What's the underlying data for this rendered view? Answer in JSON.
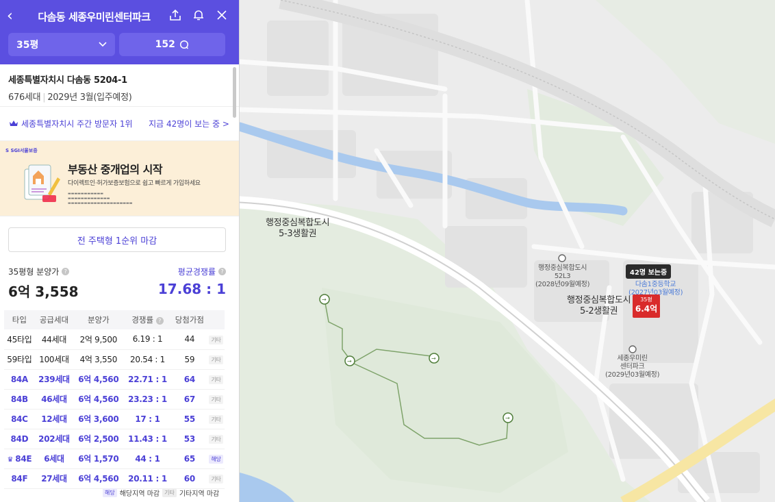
{
  "header": {
    "back_icon": "chevron-left-icon",
    "title": "다솜동 세종우미린센터파크",
    "size_selector": "35평",
    "comment_count": "152"
  },
  "address": {
    "line1": "세종특별자치시 다솜동 5204-1",
    "households": "676세대",
    "move_in": "2029년 3월(입주예정)"
  },
  "rank": {
    "left": "세종특별자치시 주간 방문자 1위",
    "right": "지금 42명이 보는 중 >"
  },
  "banner": {
    "title": "부동산 중개업의 시작",
    "subtitle": "다이렉트인·허가보증보험으로 쉽고 빠르게 가입하세요"
  },
  "closed_button": "전 주택형 1순위 마감",
  "price": {
    "label": "35평형 분양가",
    "value": "6억 3,558",
    "comp_label": "평균경쟁률",
    "comp_value": "17.68 : 1"
  },
  "table": {
    "headers": [
      "타입",
      "공급세대",
      "분양가",
      "경쟁률",
      "당첨가점",
      ""
    ],
    "rows": [
      {
        "type": "45타입",
        "supply": "44세대",
        "price": "2억 9,500",
        "rate": "6.19 : 1",
        "score": "44",
        "tag": "기타",
        "hl": false
      },
      {
        "type": "59타입",
        "supply": "100세대",
        "price": "4억 3,550",
        "rate": "20.54 : 1",
        "score": "59",
        "tag": "기타",
        "hl": false
      },
      {
        "type": "84A",
        "supply": "239세대",
        "price": "6억 4,560",
        "rate": "22.71 : 1",
        "score": "64",
        "tag": "기타",
        "hl": true
      },
      {
        "type": "84B",
        "supply": "46세대",
        "price": "6억 4,560",
        "rate": "23.23 : 1",
        "score": "67",
        "tag": "기타",
        "hl": true
      },
      {
        "type": "84C",
        "supply": "12세대",
        "price": "6억 3,600",
        "rate": "17 : 1",
        "score": "55",
        "tag": "기타",
        "hl": true
      },
      {
        "type": "84D",
        "supply": "202세대",
        "price": "6억 2,500",
        "rate": "11.43 : 1",
        "score": "53",
        "tag": "기타",
        "hl": true
      },
      {
        "type": "84E",
        "supply": "6세대",
        "price": "6억 1,570",
        "rate": "44 : 1",
        "score": "65",
        "tag": "해당",
        "hl": true
      },
      {
        "type": "84F",
        "supply": "27세대",
        "price": "6억 4,560",
        "rate": "20.11 : 1",
        "score": "60",
        "tag": "기타",
        "hl": true
      }
    ]
  },
  "legend": {
    "chip1": "해당",
    "label1": "해당지역 마감",
    "chip2": "기타",
    "label2": "기타지역 마감"
  },
  "map": {
    "labels": {
      "area1": "행정중심복합도시\n5-3생활권",
      "area2": "행정중심복합도시\n5-2생활권",
      "poi1": "행정중심복합도시\n52L3\n(2028년09월예정)",
      "poi2": "세종우미린\n센터파크\n(2029년03월예정)",
      "school": "다솜1중등학교\n(2027년03월예정)"
    },
    "marker": {
      "viewers": "42명 보는중",
      "size": "35평",
      "price": "6.4억"
    }
  },
  "colors": {
    "accent": "#5b4fe0",
    "highlight": "#4b40d6",
    "marker": "#d92b2b",
    "river": "#a9c9ee"
  }
}
